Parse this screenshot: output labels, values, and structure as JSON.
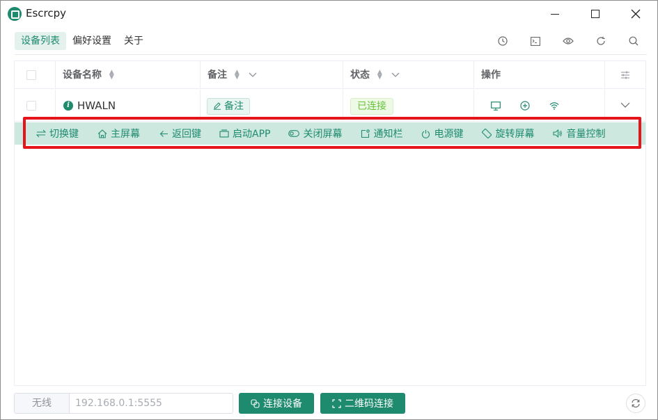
{
  "window": {
    "title": "Escrcpy"
  },
  "tabs": [
    {
      "label": "设备列表",
      "active": true
    },
    {
      "label": "偏好设置",
      "active": false
    },
    {
      "label": "关于",
      "active": false
    }
  ],
  "top_icons": [
    "history-icon",
    "terminal-icon",
    "eye-icon",
    "refresh-icon",
    "search-icon"
  ],
  "table": {
    "headers": {
      "name": "设备名称",
      "note": "备注",
      "status": "状态",
      "ops": "操作"
    },
    "rows": [
      {
        "name": "HWALN",
        "note": "备注",
        "status": "已连接"
      }
    ]
  },
  "controls": [
    {
      "icon": "switch-icon",
      "label": "切换键"
    },
    {
      "icon": "home-icon",
      "label": "主屏幕"
    },
    {
      "icon": "back-arrow-icon",
      "label": "返回键"
    },
    {
      "icon": "app-icon",
      "label": "启动APP"
    },
    {
      "icon": "toggle-icon",
      "label": "关闭屏幕"
    },
    {
      "icon": "notification-icon",
      "label": "通知栏"
    },
    {
      "icon": "power-icon",
      "label": "电源键"
    },
    {
      "icon": "rotate-icon",
      "label": "旋转屏幕"
    },
    {
      "icon": "volume-icon",
      "label": "音量控制"
    }
  ],
  "bottom": {
    "mode_label": "无线",
    "address_placeholder": "192.168.0.1:5555",
    "connect_label": "连接设备",
    "qr_label": "二维码连接"
  },
  "colors": {
    "accent": "#1e8a6e",
    "success": "#67c23a",
    "highlight": "#e5151b",
    "control_bar": "#cde8df"
  }
}
